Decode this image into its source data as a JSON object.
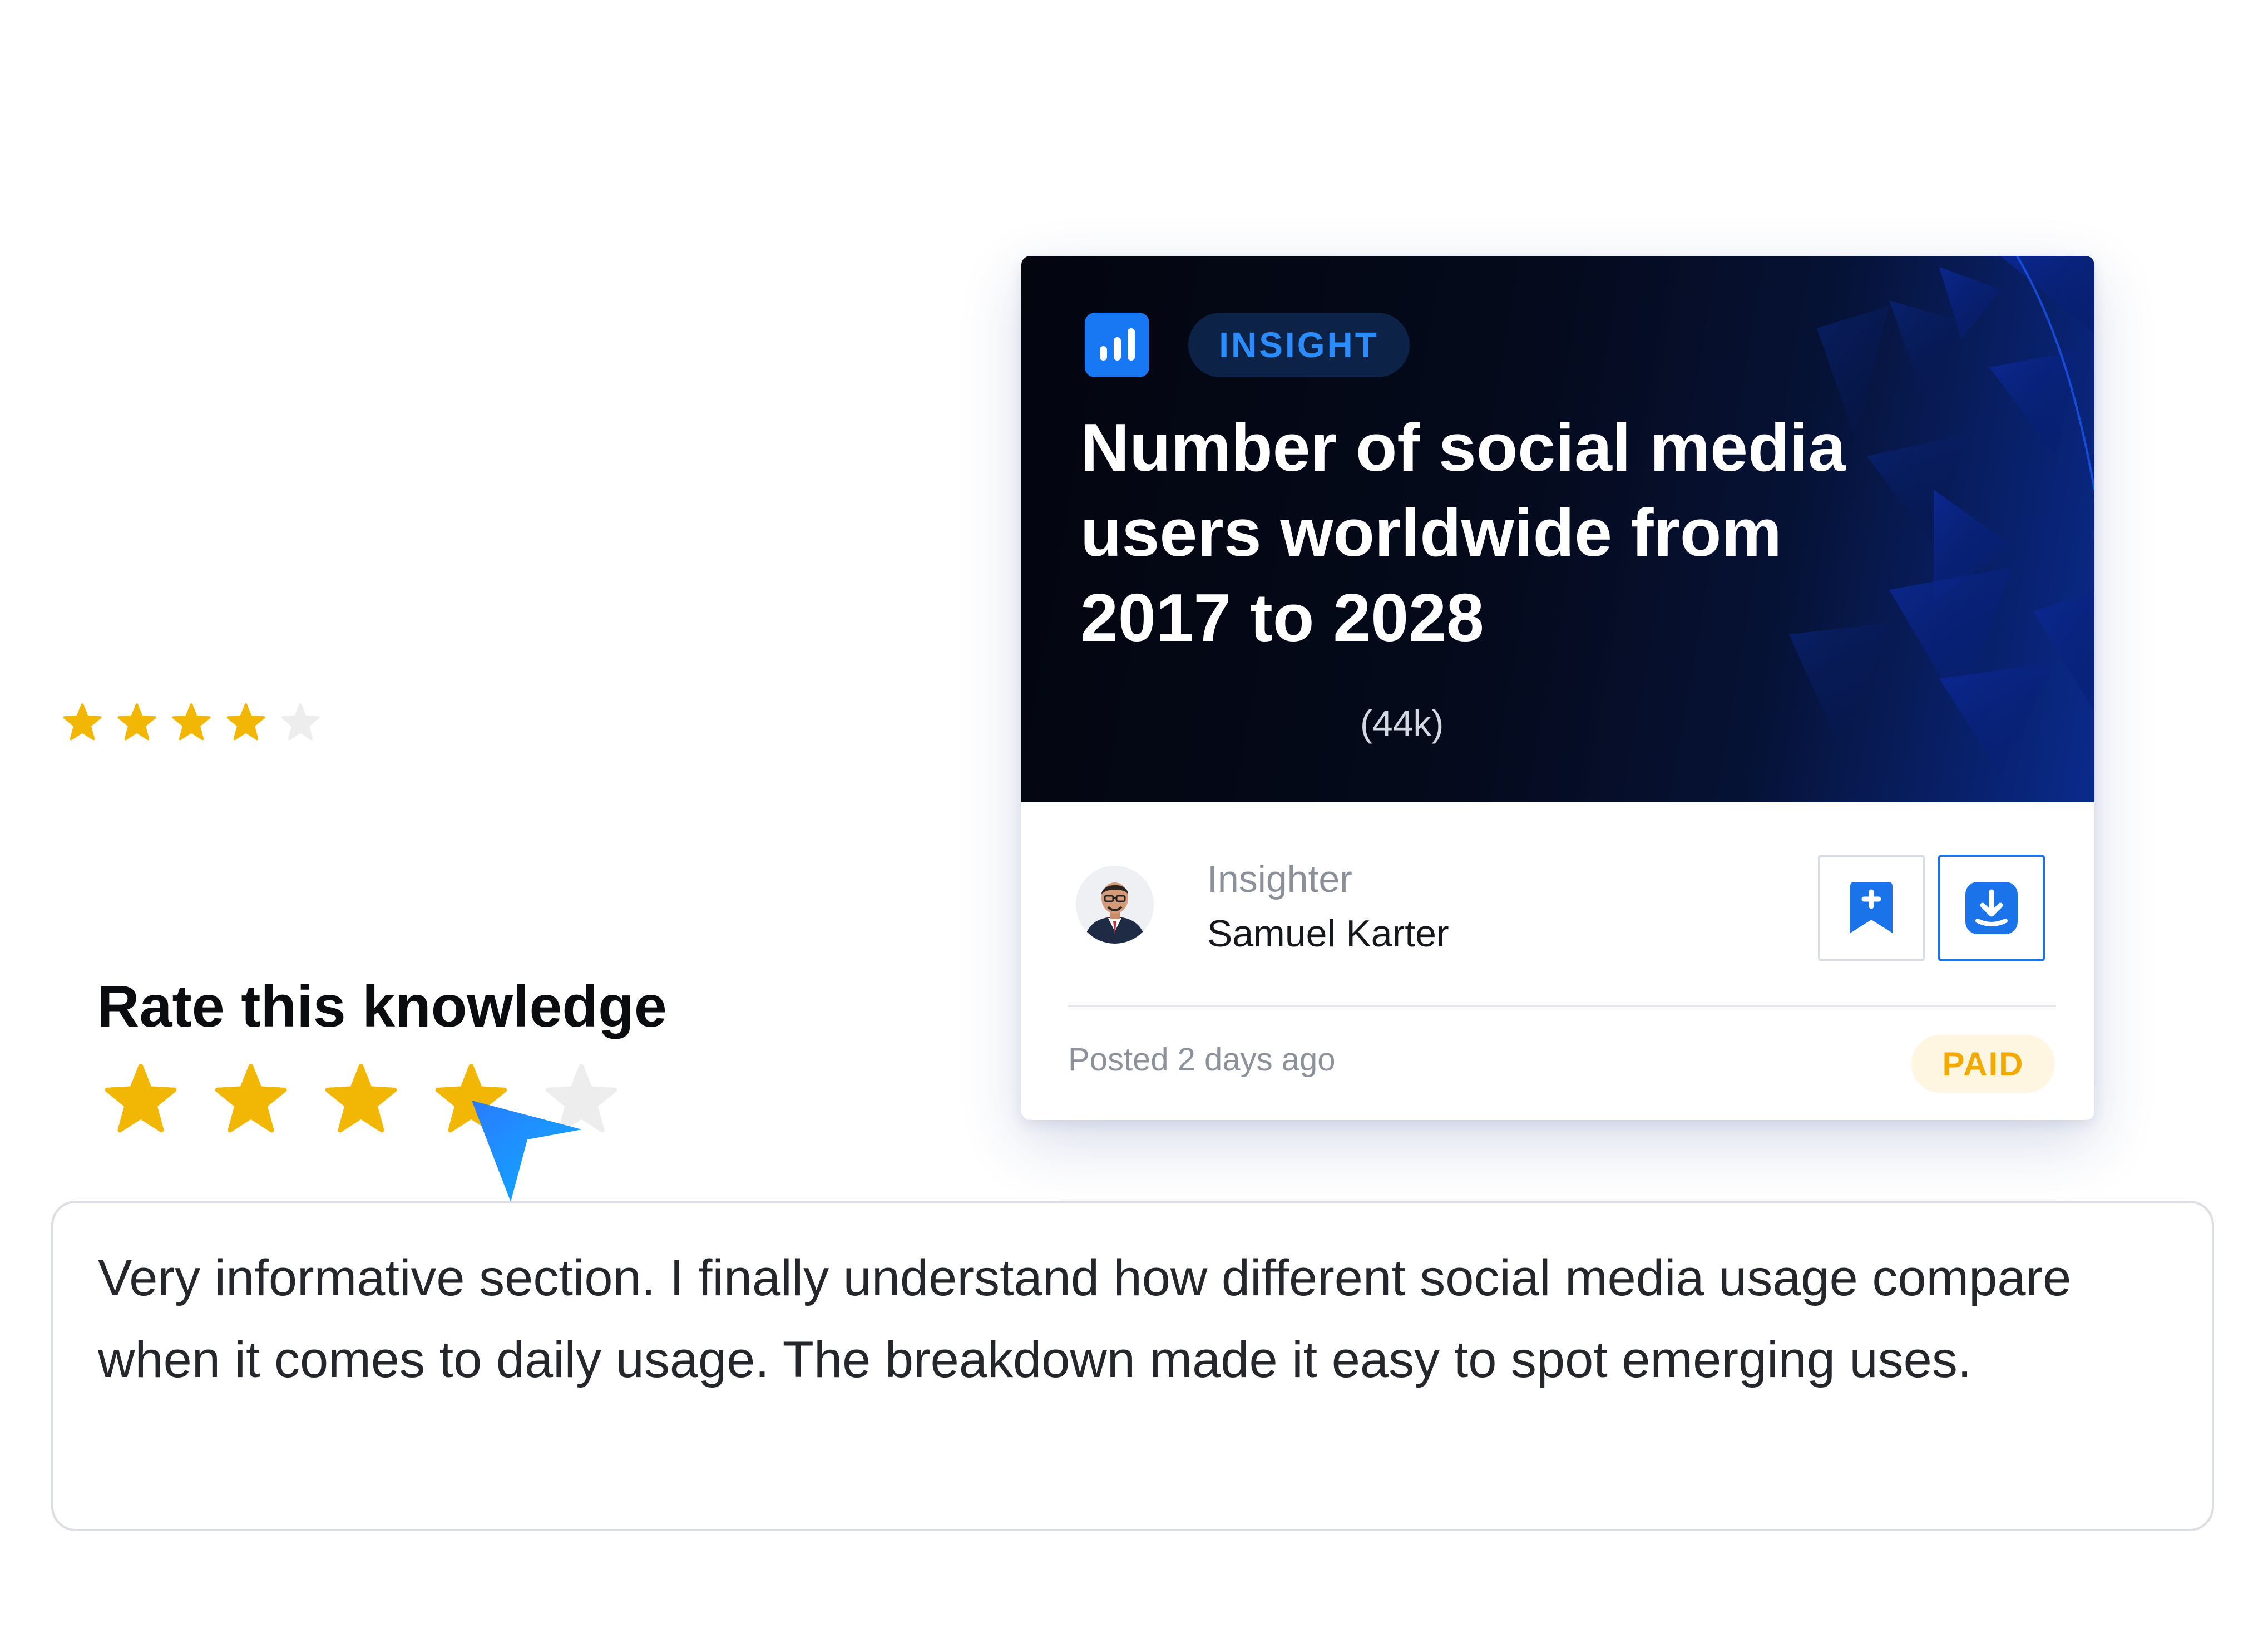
{
  "card": {
    "badge": "INSIGHT",
    "title": "Number of social media users worldwide from 2017 to 2028",
    "rating_stars": 4,
    "rating_max": 5,
    "rating_count": "(44k)",
    "role_label": "Insighter",
    "author_name": "Samuel Karter",
    "posted": "Posted 2 days ago",
    "price_badge": "PAID"
  },
  "rate": {
    "heading": "Rate this knowledge",
    "selected_stars": 4,
    "max_stars": 5
  },
  "review": {
    "text": "Very informative section. I finally understand how different social media usage compare when it comes to daily usage. The breakdown made it easy to spot emerging uses."
  },
  "colors": {
    "accent_blue": "#1a73e8",
    "star_gold": "#f2b705",
    "star_empty": "#ededed",
    "paid_text": "#f2a900",
    "hero_dark": "#03060f"
  },
  "icons": {
    "app": "bar-chart-icon",
    "bookmark": "bookmark-add-icon",
    "download": "download-icon",
    "star": "star-icon",
    "cursor": "pointer-arrow-icon"
  }
}
